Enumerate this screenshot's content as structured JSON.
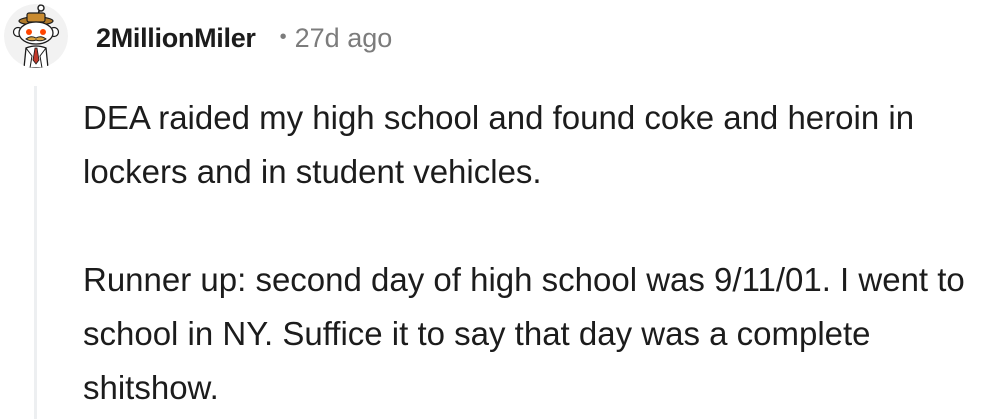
{
  "comment": {
    "author": "2MillionMiler",
    "separator": "•",
    "timestamp": "27d ago",
    "paragraphs": [
      "DEA raided my high school and found coke and heroin in lockers and in student vehicles.",
      "Runner up: second day of high school was 9/11/01. I went to school in NY. Suffice it to say that day was a complete shitshow."
    ]
  },
  "colors": {
    "text": "#1c1c1c",
    "meta": "#7c7c7c",
    "thread_line": "#edeff1",
    "background": "#ffffff"
  },
  "icons": {
    "avatar": "snoo-avatar-icon"
  }
}
